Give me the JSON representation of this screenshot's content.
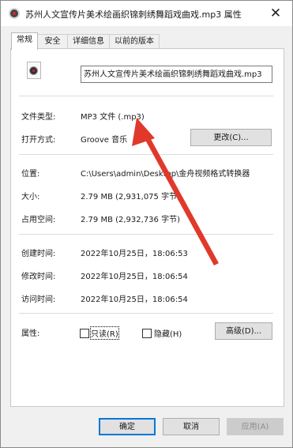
{
  "window": {
    "title": "苏州人文宣传片美术绘画织锦刺绣舞蹈戏曲戏.mp3 属性",
    "close_glyph": "✕"
  },
  "tabs": [
    {
      "label": "常规",
      "active": true
    },
    {
      "label": "安全",
      "active": false
    },
    {
      "label": "详细信息",
      "active": false
    },
    {
      "label": "以前的版本",
      "active": false
    }
  ],
  "general": {
    "file_name": "苏州人文宣传片美术绘画织锦刺绣舞蹈戏曲戏.mp3",
    "file_type_label": "文件类型:",
    "file_type_value": "MP3 文件 (.mp3)",
    "opens_with_label": "打开方式:",
    "opens_with_value": "Groove 音乐",
    "change_button": "更改(C)...",
    "location_label": "位置:",
    "location_value": "C:\\Users\\admin\\Desktop\\金舟视频格式转换器",
    "size_label": "大小:",
    "size_value": "2.79 MB (2,931,075 字节)",
    "size_on_disk_label": "占用空间:",
    "size_on_disk_value": "2.79 MB (2,932,736 字节)",
    "created_label": "创建时间:",
    "created_value": "2022年10月25日，18:06:53",
    "modified_label": "修改时间:",
    "modified_value": "2022年10月25日，18:06:54",
    "accessed_label": "访问时间:",
    "accessed_value": "2022年10月25日，18:06:54",
    "attributes_label": "属性:",
    "readonly_label": "只读(R)",
    "hidden_label": "隐藏(H)",
    "advanced_button": "高级(D)..."
  },
  "footer": {
    "ok": "确定",
    "cancel": "取消",
    "apply": "应用(A)"
  },
  "annotation": {
    "arrow_color": "#e0392b"
  }
}
